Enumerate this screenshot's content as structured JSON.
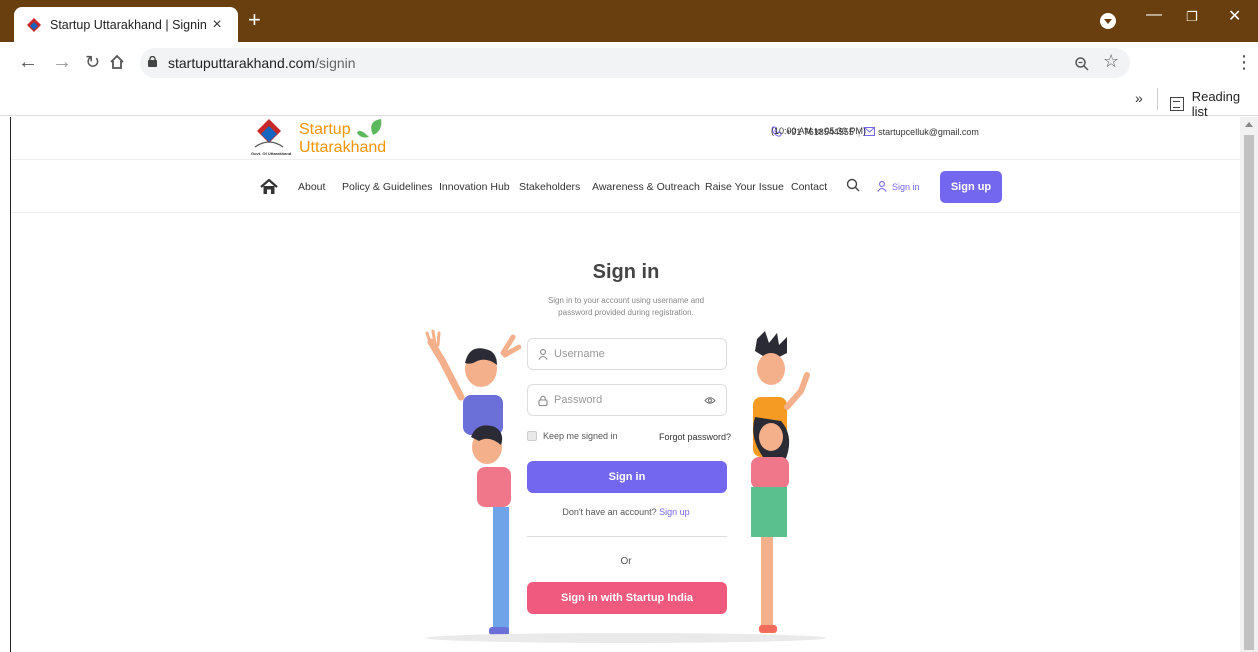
{
  "browser": {
    "tab_title": "Startup Uttarakhand | Signin",
    "tab_close": "×",
    "new_tab": "+",
    "url_host": "startuputtarakhand.com",
    "url_path": "/signin",
    "bookmarks_chevron": "»",
    "reading_list": "Reading list"
  },
  "site": {
    "logo_line1": "Startup",
    "logo_line2": "Uttarakhand",
    "logo_caption": "Govt. Of Uttarakhand",
    "phone": "+91 7618544555",
    "email": "startupcelluk@gmail.com",
    "hours": "(10:00 AM to 05:30 PM)",
    "nav": [
      "About",
      "Policy & Guidelines",
      "Innovation Hub",
      "Stakeholders",
      "Awareness & Outreach",
      "Raise Your Issue",
      "Contact"
    ],
    "nav_signin": "Sign in",
    "nav_signup": "Sign up"
  },
  "signin": {
    "title": "Sign in",
    "subtitle": "Sign in to your account using username and password provided during registration.",
    "username_placeholder": "Username",
    "password_placeholder": "Password",
    "keep_signed_in": "Keep me signed in",
    "forgot_password": "Forgot password?",
    "signin_button": "Sign in",
    "no_account": "Don't have an account?",
    "signup_link": "Sign up",
    "or": "Or",
    "startup_india_button": "Sign in with Startup India"
  },
  "colors": {
    "tabbar": "#6a3f10",
    "primary": "#7367f0",
    "startup_india": "#f05a7e",
    "logo_orange": "#f29400"
  }
}
